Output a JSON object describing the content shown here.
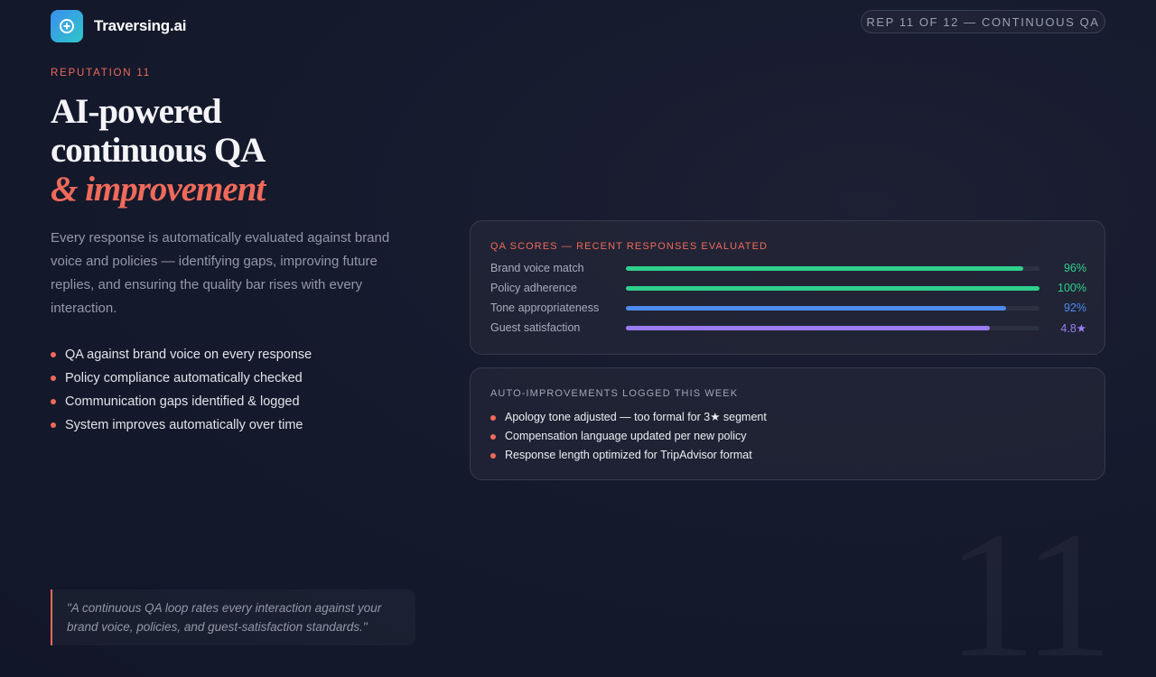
{
  "brand": {
    "name": "Traversing.ai",
    "logo_icon": "plus-circle-icon"
  },
  "progress_pill": "REP 11 OF 12 — CONTINUOUS QA",
  "eyebrow": "REPUTATION 11",
  "headline": {
    "line1": "AI-powered",
    "line2": "continuous QA",
    "accent": "& improvement"
  },
  "description": "Every response is automatically evaluated against brand voice and policies — identifying gaps, improving future replies, and ensuring the quality bar rises with every interaction.",
  "bullets": [
    "QA against brand voice on every response",
    "Policy compliance automatically checked",
    "Communication gaps identified & logged",
    "System improves automatically over time"
  ],
  "qa_scores": {
    "title": "QA SCORES — RECENT RESPONSES EVALUATED",
    "rows": [
      {
        "label": "Brand voice match",
        "value_text": "96%",
        "fraction": 0.96,
        "color": "#2ed08c"
      },
      {
        "label": "Policy adherence",
        "value_text": "100%",
        "fraction": 1.0,
        "color": "#2ed08c"
      },
      {
        "label": "Tone appropriateness",
        "value_text": "92%",
        "fraction": 0.92,
        "color": "#4d8bf0"
      },
      {
        "label": "Guest satisfaction",
        "value_text": "4.8★",
        "fraction": 0.88,
        "color": "#9b7cf2"
      }
    ]
  },
  "improvements": {
    "title": "AUTO-IMPROVEMENTS LOGGED THIS WEEK",
    "items": [
      "Apology tone adjusted — too formal for 3★ segment",
      "Compensation language updated per new policy",
      "Response length optimized for TripAdvisor format"
    ]
  },
  "quote": "\"A continuous QA loop rates every interaction against your brand voice, policies, and guest-satisfaction standards.\"",
  "slide_number": "11",
  "colors": {
    "accent": "#ef6a5a",
    "green": "#2ed08c",
    "blue": "#4d8bf0",
    "purple": "#9b7cf2"
  }
}
